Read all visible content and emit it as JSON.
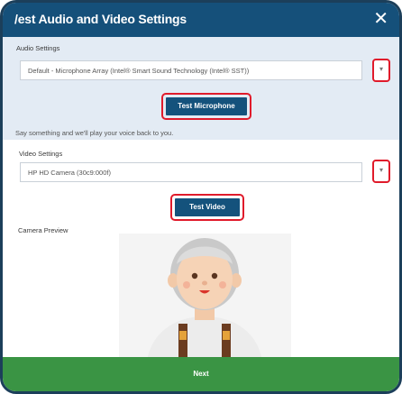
{
  "dialog": {
    "title": "/est Audio and Video Settings",
    "close_glyph": "✕"
  },
  "audio": {
    "label": "Audio Settings",
    "selected_device": "Default - Microphone Array (Intel® Smart Sound Technology (Intel® SST))",
    "dropdown_glyph": "▾",
    "test_button_label": "Test Microphone",
    "hint": "Say something and we'll play your voice back to you."
  },
  "video": {
    "label": "Video Settings",
    "selected_device": "HP HD Camera (30c9:000f)",
    "dropdown_glyph": "▾",
    "test_button_label": "Test Video",
    "preview_label": "Camera Preview"
  },
  "footer": {
    "next_label": "Next"
  },
  "colors": {
    "title_bar": "#15507a",
    "button": "#14527c",
    "highlight": "#e01b2b",
    "footer": "#3a9444",
    "audio_section_bg": "#e3ebf4"
  }
}
